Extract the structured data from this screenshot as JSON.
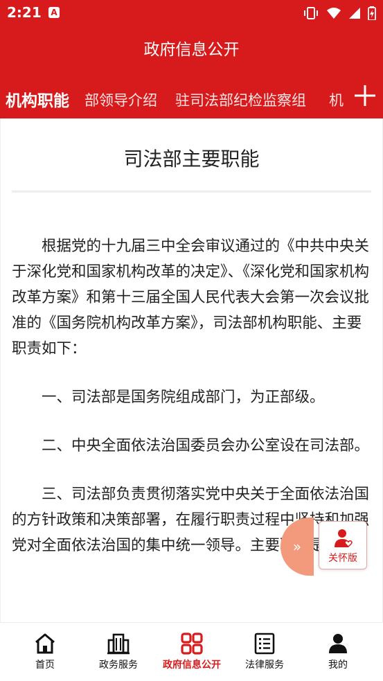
{
  "status_bar": {
    "time": "2:21",
    "badge": "A"
  },
  "header": {
    "title": "政府信息公开"
  },
  "tabs": [
    {
      "label": "机构职能",
      "active": true
    },
    {
      "label": "部领导介绍",
      "active": false
    },
    {
      "label": "驻司法部纪检监察组",
      "active": false
    },
    {
      "label": "机",
      "active": false
    }
  ],
  "article": {
    "title": "司法部主要职能",
    "paragraphs": [
      "根据党的十九届三中全会审议通过的《中共中央关于深化党和国家机构改革的决定》、《深化党和国家机构改革方案》和第十三届全国人民代表大会第一次会议批准的《国务院机构改革方案》，司法部机构职能、主要职责如下：",
      "一、司法部是国务院组成部门，为正部级。",
      "二、中央全面依法治国委员会办公室设在司法部。",
      "三、司法部负责贯彻落实党中央关于全面依法治国的方针政策和决策部署，在履行职责过程中坚持和加强党对全面依法治国的集中统一领导。主要职责是："
    ]
  },
  "floating": {
    "expand_symbol": "»",
    "care_label": "关怀版"
  },
  "bottom_nav": [
    {
      "label": "首页",
      "icon": "home-icon",
      "active": false
    },
    {
      "label": "政务服务",
      "icon": "building-icon",
      "active": false
    },
    {
      "label": "政府信息公开",
      "icon": "grid-icon",
      "active": true
    },
    {
      "label": "法律服务",
      "icon": "list-document-icon",
      "active": false
    },
    {
      "label": "我的",
      "icon": "user-icon",
      "active": false
    }
  ],
  "colors": {
    "brand": "#d71a1b",
    "care_floater": "#f39a7c"
  }
}
